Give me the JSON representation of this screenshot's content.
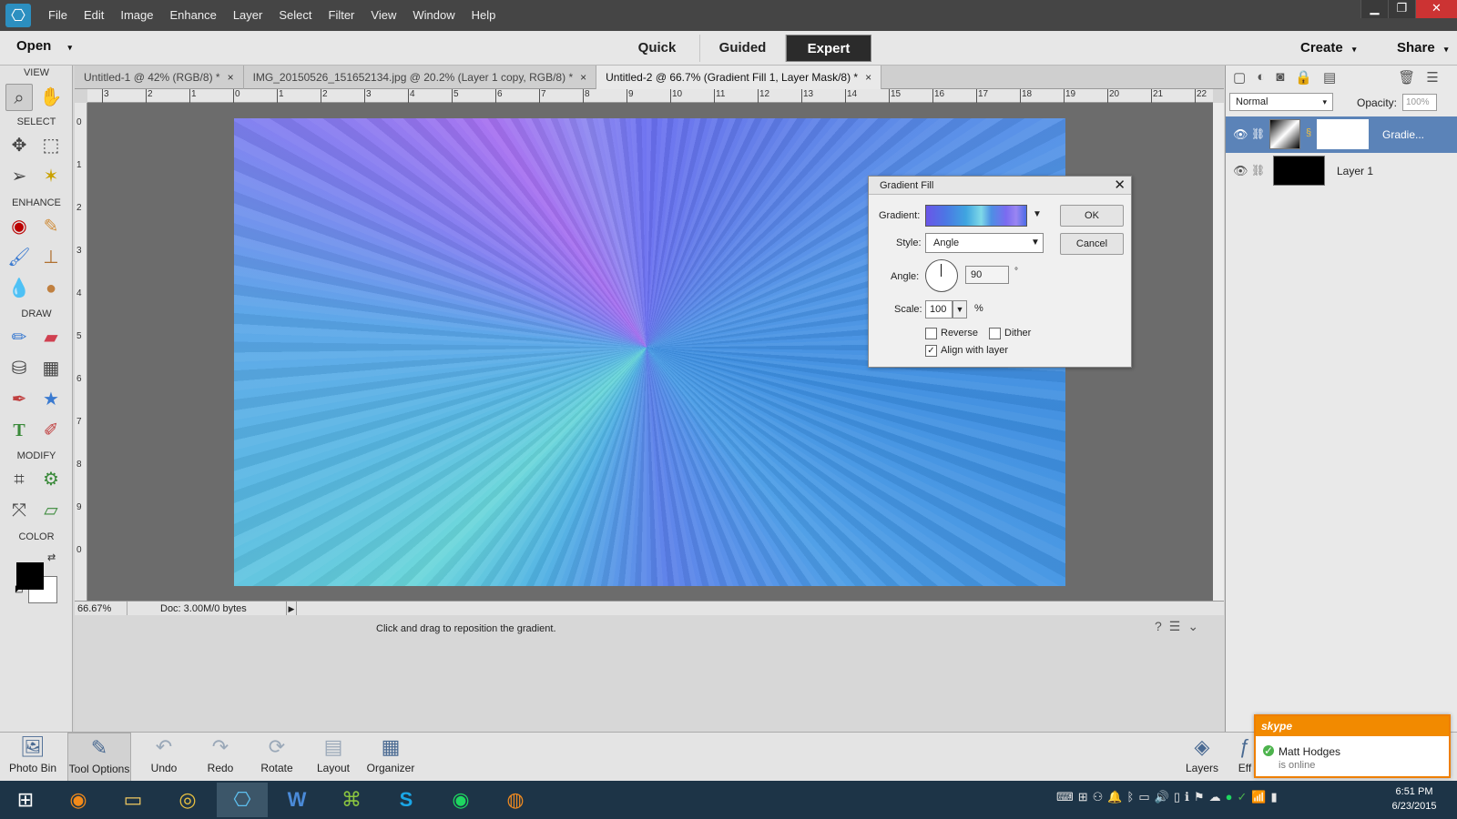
{
  "menubar": {
    "items": [
      "File",
      "Edit",
      "Image",
      "Enhance",
      "Layer",
      "Select",
      "Filter",
      "View",
      "Window",
      "Help"
    ]
  },
  "modebar": {
    "open": "Open",
    "modes": [
      "Quick",
      "Guided",
      "Expert"
    ],
    "active_mode": "Expert",
    "create": "Create",
    "share": "Share"
  },
  "toolbox": {
    "sections": [
      "VIEW",
      "SELECT",
      "ENHANCE",
      "DRAW",
      "MODIFY",
      "COLOR"
    ]
  },
  "tabs": [
    "Untitled-1 @ 42% (RGB/8) *",
    "IMG_20150526_151652134.jpg @ 20.2% (Layer 1 copy, RGB/8) *",
    "Untitled-2 @ 66.7% (Gradient Fill 1, Layer Mask/8) *"
  ],
  "ruler": {
    "h": [
      "3",
      "2",
      "1",
      "0",
      "1",
      "2",
      "3",
      "4",
      "5",
      "6",
      "7",
      "8",
      "9",
      "10",
      "11",
      "12",
      "13",
      "14",
      "15",
      "16",
      "17",
      "18",
      "19",
      "20",
      "21",
      "22"
    ],
    "v": [
      "0",
      "1",
      "2",
      "3",
      "4",
      "5",
      "6",
      "7",
      "8",
      "9",
      "0"
    ]
  },
  "status": {
    "zoom": "66.67%",
    "doc": "Doc: 3.00M/0 bytes",
    "hint": "Click and drag to reposition the gradient."
  },
  "panel": {
    "blend_mode": "Normal",
    "opacity_label": "Opacity:",
    "opacity_value": "100%"
  },
  "layers": [
    {
      "name": "Gradie...",
      "selected": true
    },
    {
      "name": "Layer 1",
      "selected": false
    }
  ],
  "dialog": {
    "title": "Gradient Fill",
    "gradient_label": "Gradient:",
    "style_label": "Style:",
    "style_value": "Angle",
    "angle_label": "Angle:",
    "angle_value": "90",
    "degree": "°",
    "scale_label": "Scale:",
    "scale_value": "100",
    "percent": "%",
    "reverse": "Reverse",
    "dither": "Dither",
    "align": "Align with layer",
    "ok": "OK",
    "cancel": "Cancel"
  },
  "bottombar": [
    "Photo Bin",
    "Tool Options",
    "Undo",
    "Redo",
    "Rotate",
    "Layout",
    "Organizer",
    "Layers",
    "Eff"
  ],
  "skype": {
    "brand": "skype",
    "name": "Matt Hodges",
    "status": "is online"
  },
  "clock": {
    "time": "6:51 PM",
    "date": "6/23/2015"
  }
}
